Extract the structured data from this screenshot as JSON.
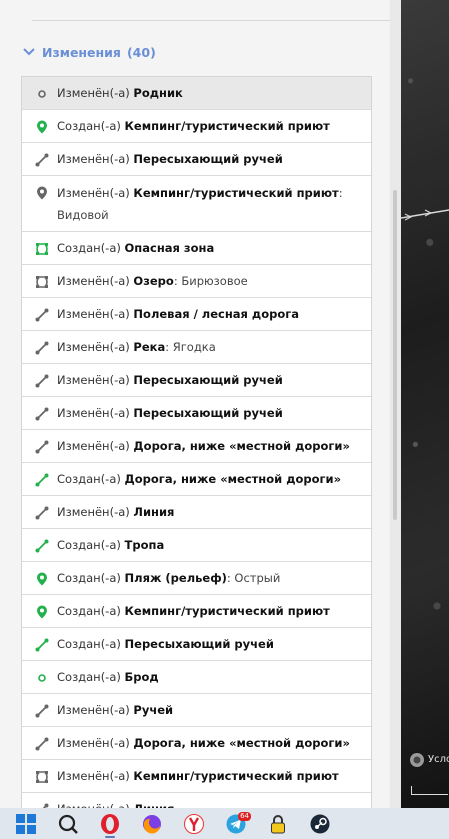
{
  "section": {
    "title": "Изменения",
    "count": "(40)"
  },
  "changes": [
    {
      "icon": "dot-gray",
      "verb": "Изменён(-а)",
      "object": "Родник",
      "detail": ""
    },
    {
      "icon": "pin-green",
      "verb": "Создан(-а)",
      "object": "Кемпинг/туристический приют",
      "detail": ""
    },
    {
      "icon": "line-gray",
      "verb": "Изменён(-а)",
      "object": "Пересыхающий ручей",
      "detail": ""
    },
    {
      "icon": "pin-gray",
      "verb": "Изменён(-а)",
      "object": "Кемпинг/туристический приют",
      "detail": ": Видовой"
    },
    {
      "icon": "area-green",
      "verb": "Создан(-а)",
      "object": "Опасная зона",
      "detail": ""
    },
    {
      "icon": "area-gray",
      "verb": "Изменён(-а)",
      "object": "Озеро",
      "detail": ": Бирюзовое"
    },
    {
      "icon": "line-gray",
      "verb": "Изменён(-а)",
      "object": "Полевая / лесная дорога",
      "detail": ""
    },
    {
      "icon": "line-gray",
      "verb": "Изменён(-а)",
      "object": "Река",
      "detail": ": Ягодка"
    },
    {
      "icon": "line-gray",
      "verb": "Изменён(-а)",
      "object": "Пересыхающий ручей",
      "detail": ""
    },
    {
      "icon": "line-gray",
      "verb": "Изменён(-а)",
      "object": "Пересыхающий ручей",
      "detail": ""
    },
    {
      "icon": "line-gray",
      "verb": "Изменён(-а)",
      "object": "Дорога, ниже «местной дороги»",
      "detail": ""
    },
    {
      "icon": "line-green",
      "verb": "Создан(-а)",
      "object": "Дорога, ниже «местной дороги»",
      "detail": ""
    },
    {
      "icon": "line-gray",
      "verb": "Изменён(-а)",
      "object": "Линия",
      "detail": ""
    },
    {
      "icon": "line-green",
      "verb": "Создан(-а)",
      "object": "Тропа",
      "detail": ""
    },
    {
      "icon": "pin-green",
      "verb": "Создан(-а)",
      "object": "Пляж (рельеф)",
      "detail": ": Острый"
    },
    {
      "icon": "pin-green",
      "verb": "Создан(-а)",
      "object": "Кемпинг/туристический приют",
      "detail": ""
    },
    {
      "icon": "line-green",
      "verb": "Создан(-а)",
      "object": "Пересыхающий ручей",
      "detail": ""
    },
    {
      "icon": "dot-green",
      "verb": "Создан(-а)",
      "object": "Брод",
      "detail": ""
    },
    {
      "icon": "line-gray",
      "verb": "Изменён(-а)",
      "object": "Ручей",
      "detail": ""
    },
    {
      "icon": "line-gray",
      "verb": "Изменён(-а)",
      "object": "Дорога, ниже «местной дороги»",
      "detail": ""
    },
    {
      "icon": "area-gray",
      "verb": "Изменён(-а)",
      "object": "Кемпинг/туристический приют",
      "detail": ""
    },
    {
      "icon": "line-gray",
      "verb": "Изменён(-а)",
      "object": "Линия",
      "detail": ""
    }
  ],
  "map": {
    "attribution_partial": "Усло"
  },
  "taskbar": {
    "apps": [
      "windows-start-icon",
      "search-icon",
      "opera-icon",
      "firefox-icon",
      "yandex-browser-icon",
      "telegram-icon",
      "vpn-lock-icon",
      "steam-icon"
    ],
    "telegram_badge": "64"
  },
  "colors": {
    "accent": "#6b8fd6",
    "created_green": "#22b14c",
    "modified_gray": "#666666"
  }
}
